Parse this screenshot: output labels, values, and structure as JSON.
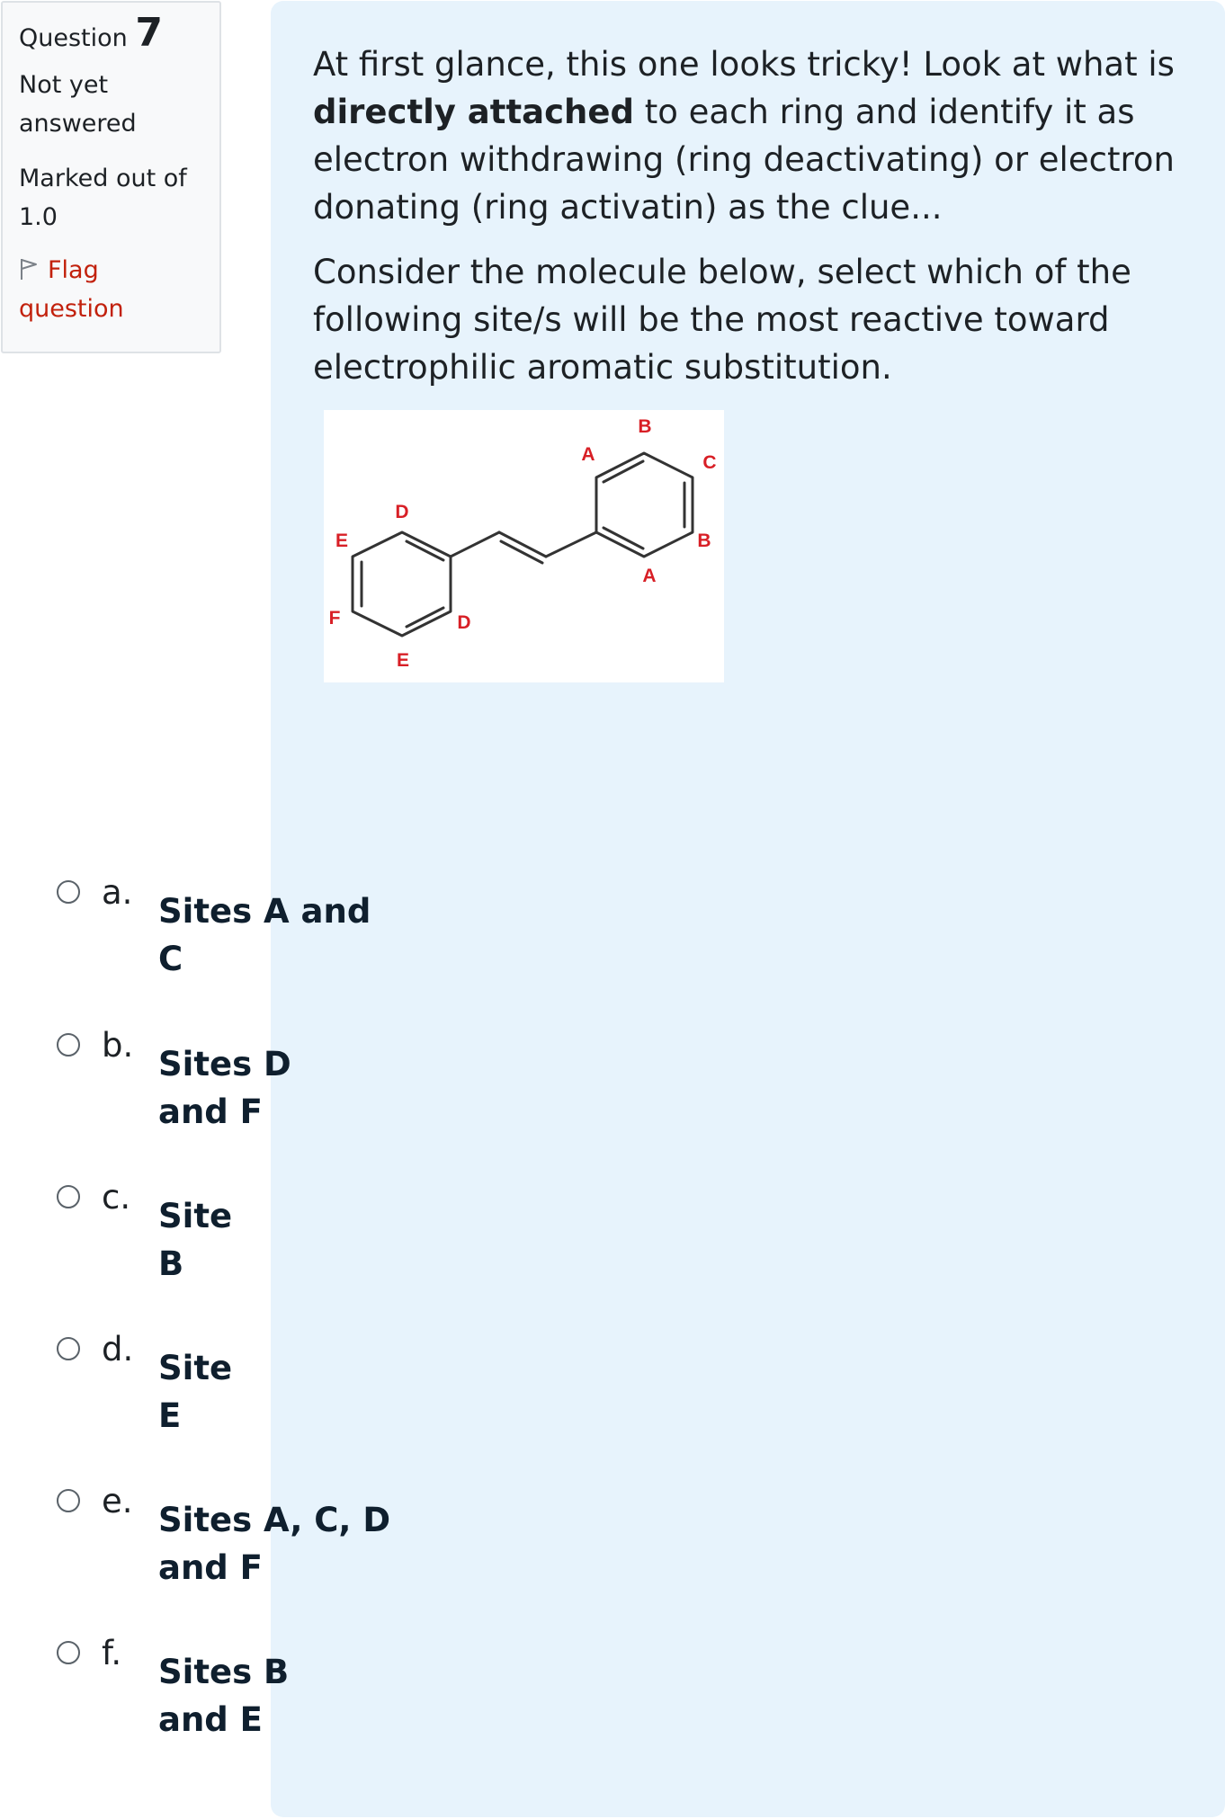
{
  "info": {
    "question_label": "Question",
    "question_number": "7",
    "status_line1": "Not yet",
    "status_line2": "answered",
    "marks_line1": "Marked out of",
    "marks_line2": "1.0",
    "flag_line1": "Flag",
    "flag_line2": "question"
  },
  "question": {
    "p1_part1": "At first glance, this one looks tricky! Look at what is ",
    "p1_bold": "directly attached",
    "p1_part2": " to each ring and identify it as electron withdrawing (ring deactivating) or electron donating (ring activatin) as the clue...",
    "p2": "Consider the molecule below, select which of the following site/s will be the most reactive toward electrophilic aromatic substitution."
  },
  "molecule_labels": {
    "top_right_a": "A",
    "top_b": "B",
    "top_c": "C",
    "right_b": "B",
    "bottom_a": "A",
    "left_d": "D",
    "left_e_top": "E",
    "left_f": "F",
    "left_e_bottom": "E",
    "right_d": "D"
  },
  "colors": {
    "molecule_label": "#d81f26",
    "flag": "#c2210c",
    "panel_bg": "#e7f3fc"
  },
  "answers": [
    {
      "letter": "a.",
      "line1": "Sites A and",
      "line2": "C"
    },
    {
      "letter": "b.",
      "line1": "Sites D",
      "line2": "and F"
    },
    {
      "letter": "c.",
      "line1": "Site",
      "line2": "B"
    },
    {
      "letter": "d.",
      "line1": "Site",
      "line2": "E"
    },
    {
      "letter": "e.",
      "line1": "Sites A, C, D",
      "line2": "and F"
    },
    {
      "letter": "f.",
      "line1": "Sites B",
      "line2": "and E"
    }
  ]
}
